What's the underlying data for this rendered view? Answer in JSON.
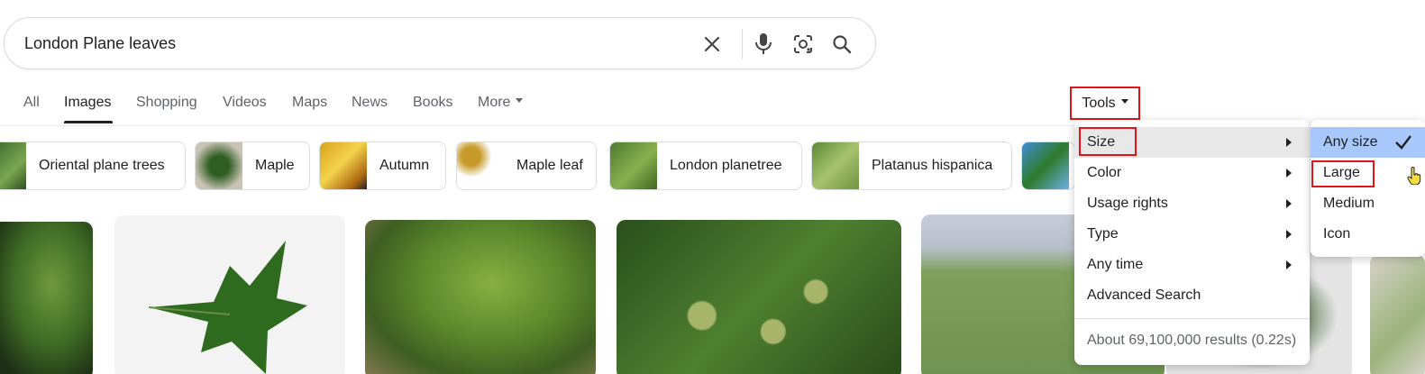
{
  "search": {
    "query": "London Plane leaves",
    "icons": [
      "clear-icon",
      "microphone-icon",
      "lens-icon",
      "search-icon"
    ]
  },
  "nav": {
    "tabs": [
      {
        "label": "All"
      },
      {
        "label": "Images"
      },
      {
        "label": "Shopping"
      },
      {
        "label": "Videos"
      },
      {
        "label": "Maps"
      },
      {
        "label": "News"
      },
      {
        "label": "Books"
      },
      {
        "label": "More"
      }
    ],
    "tools_label": "Tools"
  },
  "chips": [
    {
      "label": "Oriental plane trees"
    },
    {
      "label": "Maple"
    },
    {
      "label": "Autumn"
    },
    {
      "label": "Maple leaf"
    },
    {
      "label": "London planetree"
    },
    {
      "label": "Platanus hispanica"
    }
  ],
  "tools_menu": {
    "items": [
      {
        "label": "Size"
      },
      {
        "label": "Color"
      },
      {
        "label": "Usage rights"
      },
      {
        "label": "Type"
      },
      {
        "label": "Any time"
      },
      {
        "label": "Advanced Search"
      }
    ],
    "results_text": "About 69,100,000 results (0.22s)"
  },
  "size_menu": {
    "items": [
      {
        "label": "Any size"
      },
      {
        "label": "Large"
      },
      {
        "label": "Medium"
      },
      {
        "label": "Icon"
      }
    ]
  },
  "colors": {
    "highlight_red": "#e0141a",
    "selected_blue": "#a8c7fa"
  }
}
